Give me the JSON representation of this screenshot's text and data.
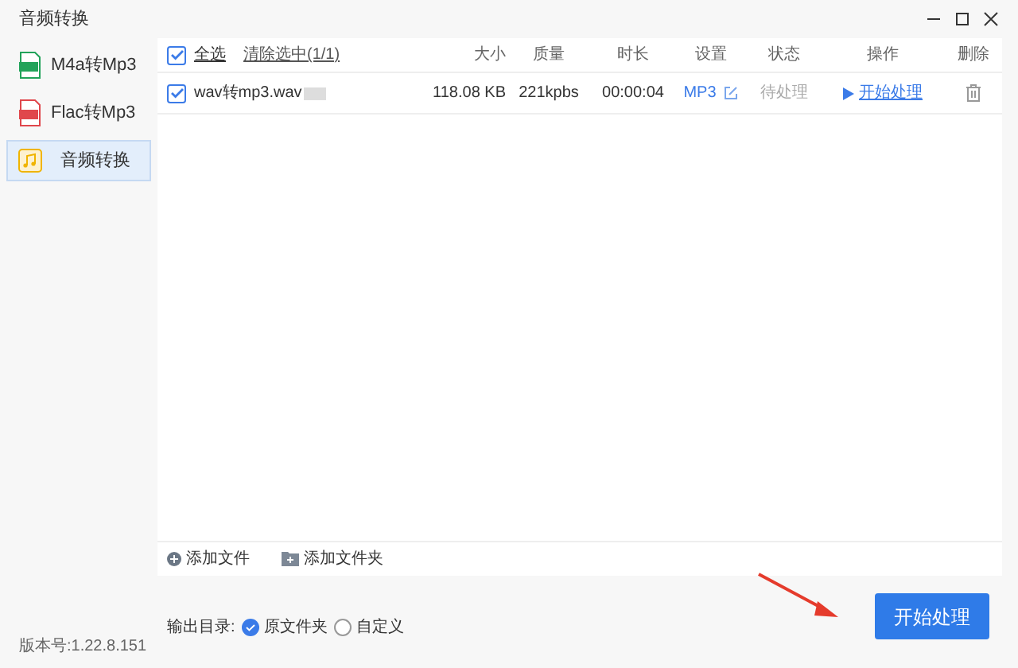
{
  "window": {
    "title": "音频转换"
  },
  "sidebar": {
    "items": [
      {
        "label": "M4a转Mp3",
        "kind": "m4a",
        "selected": false
      },
      {
        "label": "Flac转Mp3",
        "kind": "flac",
        "selected": false
      },
      {
        "label": "音频转换",
        "kind": "audio",
        "selected": true
      }
    ]
  },
  "table": {
    "select_all": {
      "label": "全选",
      "checked": true
    },
    "clear_selection": "清除选中(1/1)",
    "columns": [
      "大小",
      "质量",
      "时长",
      "设置",
      "状态",
      "操作",
      "删除"
    ],
    "rows": [
      {
        "checked": true,
        "name": "wav转mp3.wav",
        "size": "118.08 KB",
        "quality": "221kpbs",
        "duration": "00:00:04",
        "format": "MP3",
        "status": "待处理",
        "action": "开始处理"
      }
    ]
  },
  "toolbar": {
    "add_file": "添加文件",
    "add_folder": "添加文件夹"
  },
  "output": {
    "label": "输出目录:",
    "options": [
      {
        "label": "原文件夹",
        "selected": true
      },
      {
        "label": "自定义",
        "selected": false
      }
    ]
  },
  "version": "版本号:1.22.8.151",
  "start_button": "开始处理"
}
